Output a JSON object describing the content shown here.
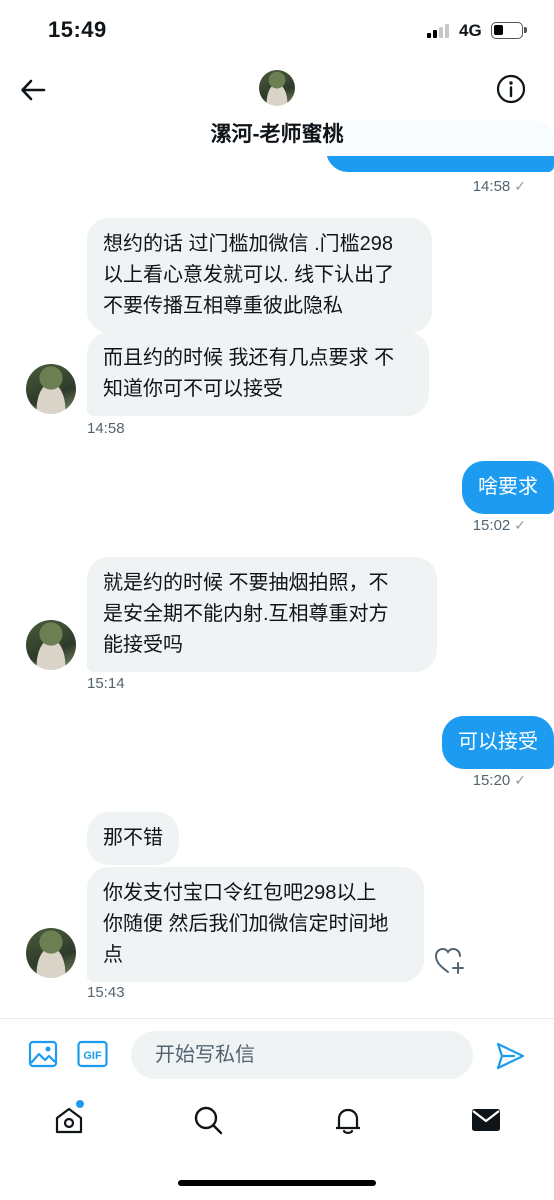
{
  "status_bar": {
    "time": "15:49",
    "network": "4G"
  },
  "header": {
    "contact_name": "漯河-老师蜜桃"
  },
  "messages": [
    {
      "dir": "out",
      "partial": true,
      "time": "14:58"
    },
    {
      "dir": "in",
      "text_lines": [
        "想约的话 过门槛加微信 .门槛298",
        "以上看心意发就可以. 线下认出了",
        "不要传播互相尊重彼此隐私"
      ]
    },
    {
      "dir": "in",
      "text_lines": [
        "而且约的时候 我还有几点要求 不",
        "知道你可不可以接受"
      ],
      "time": "14:58"
    },
    {
      "dir": "out",
      "text": "啥要求",
      "time": "15:02"
    },
    {
      "dir": "in",
      "text_lines": [
        "就是约的时候 不要抽烟拍照，不",
        "是安全期不能内射.互相尊重对方",
        "能接受吗"
      ],
      "time": "15:14"
    },
    {
      "dir": "out",
      "text": "可以接受",
      "time": "15:20"
    },
    {
      "dir": "in",
      "text": "那不错"
    },
    {
      "dir": "in",
      "text_lines": [
        "你发支付宝口令红包吧298以上",
        "你随便 然后我们加微信定时间地",
        "点"
      ],
      "time": "15:43"
    }
  ],
  "composer": {
    "placeholder": "开始写私信",
    "gif_label": "GIF"
  },
  "tabs": [
    "home-icon",
    "search-icon",
    "notifications-icon",
    "messages-icon"
  ],
  "colors": {
    "accent": "#1d9bf0",
    "incoming_bubble": "#eff3f4",
    "text": "#0f1419",
    "muted": "#536471"
  }
}
